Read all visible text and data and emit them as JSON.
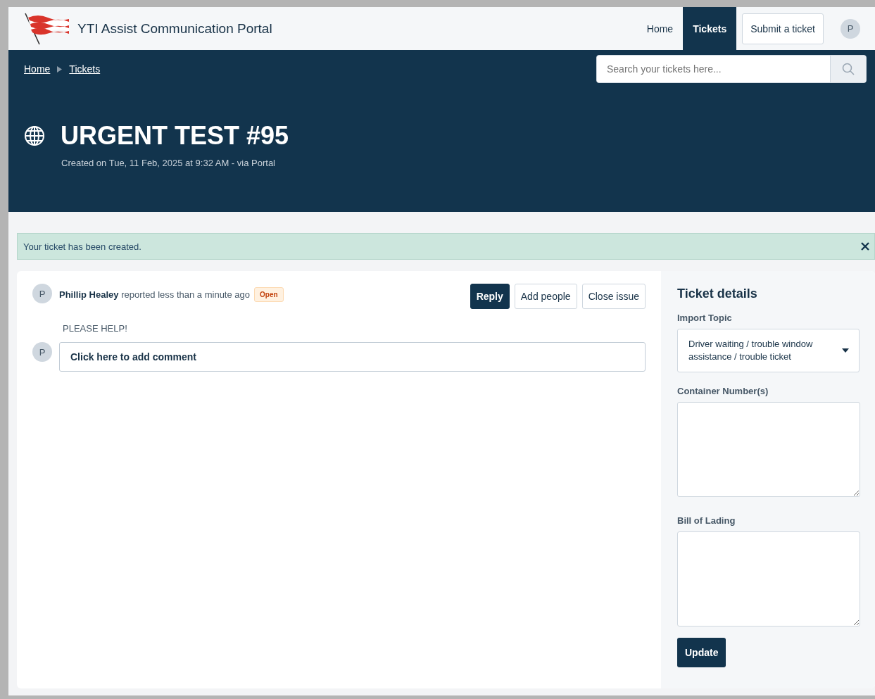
{
  "header": {
    "portal_name": "YTI Assist Communication Portal",
    "nav": [
      {
        "label": "Home",
        "selected": false
      },
      {
        "label": "Tickets",
        "selected": true
      }
    ],
    "submit_button": "Submit a ticket",
    "avatar": "P"
  },
  "banner": {
    "breadcrumb": [
      "Home",
      "Tickets"
    ],
    "search": {
      "placeholder": "Search your tickets here..."
    },
    "title": "URGENT TEST #95",
    "subtitle": "Created on Tue, 11 Feb, 2025 at 9:32 AM - via Portal"
  },
  "alert": {
    "text": "Your ticket has been created."
  },
  "ticket": {
    "avatar": "P",
    "reporter": "Phillip Healey",
    "action": "reported less than a minute ago",
    "status": "Open",
    "buttons": [
      {
        "label": "Reply",
        "primary": true
      },
      {
        "label": "Add people",
        "primary": false
      },
      {
        "label": "Close issue",
        "primary": false
      }
    ],
    "body": "PLEASE HELP!",
    "comment": {
      "avatar": "P",
      "placeholder": "Click here to add comment"
    }
  },
  "details": {
    "title": "Ticket details",
    "fields": [
      {
        "kind": "select",
        "label": "Import Topic",
        "value": "Driver waiting / trouble window assistance / trouble ticket"
      },
      {
        "kind": "textarea",
        "label": "Container Number(s)"
      },
      {
        "kind": "textarea",
        "label": "Bill of Lading"
      }
    ],
    "update_button": "Update"
  }
}
